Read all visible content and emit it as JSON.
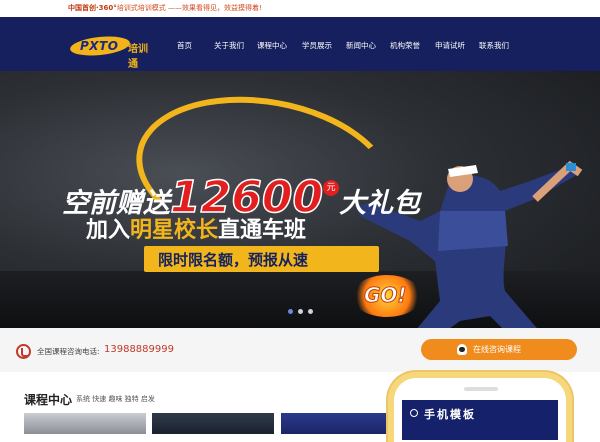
{
  "topbar": {
    "tip_prefix": "中国首创·360°",
    "tip_text": "培训式培训模式 ——效果看得见，效益摸得着!"
  },
  "header": {
    "logo_brand": "PXTO",
    "logo_cn": "培训通",
    "nav": [
      "首页",
      "关于我们",
      "课程中心",
      "学员展示",
      "新闻中心",
      "机构荣誉",
      "申请试听",
      "联系我们"
    ]
  },
  "banner": {
    "line1_prefix": "空前赠送",
    "line1_amount": "12600",
    "line1_unit": "元",
    "line1_suffix": "大礼包",
    "line2_prefix": "加入",
    "line2_highlight": "明星校长",
    "line2_suffix": "直通车班",
    "offer": "限时限名额，预报从速",
    "go": "GO!",
    "slides": 3,
    "active_slide": 1
  },
  "contact": {
    "label": "全国课程咨询电话:",
    "phone": "13988889999",
    "consult_button": "在线咨询课程"
  },
  "courses": {
    "title": "课程中心",
    "tags": "系统 快速 趣味 独特 启发"
  },
  "mobile": {
    "screen_title": "手机模板"
  },
  "colors": {
    "nav_bg": "#16205e",
    "accent": "#f3b51c",
    "red": "#e21e1e",
    "button_orange": "#f08c1e"
  }
}
